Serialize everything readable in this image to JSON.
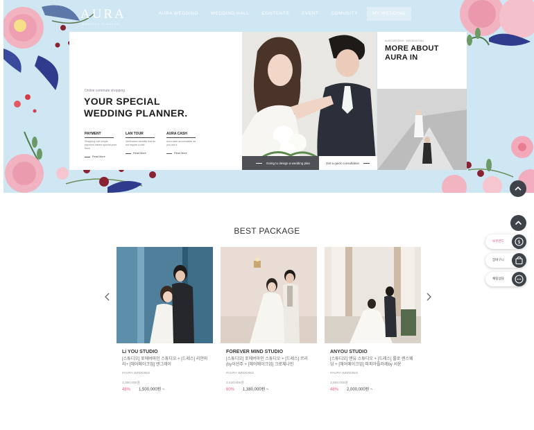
{
  "header": {
    "logo": "AURA",
    "logo_sub": "WEDDING PLANNER",
    "nav": [
      "AURA WEDDING",
      "WEDDING HALL",
      "CONTENTS",
      "EVENT",
      "COMUNITY",
      "MY WEDDING"
    ]
  },
  "hero": {
    "eyebrow": "Online commute shopping",
    "headline_line1": "YOUR SPECIAL",
    "headline_line2": "WEDDING PLANNER.",
    "features": [
      {
        "title": "PAYMENT",
        "desc": "Shopping cart simple payment instant special price fixed",
        "link": "Read More"
      },
      {
        "title": "LAN TOUR",
        "desc": "Verification benefits that do not require a visit",
        "link": "Read More"
      },
      {
        "title": "AURA CASH",
        "desc": "Aura cash accumulates as you use it",
        "link": "Read More"
      }
    ],
    "bar_left": "Going to design a wedding plan",
    "bar_right": "Get a quick consultation",
    "more_eyebrow": "AURA WEDDING · WEDDING HALL",
    "more_title_line1": "MORE ABOUT",
    "more_title_line2": "AURA IN"
  },
  "best": {
    "title": "BEST PACKAGE",
    "products": [
      {
        "name": "Li YOU STUDIO",
        "desc": "[스튜디오] 포에버마인 스튜디오 + [드레스] 리안마리+ [헤어메이크업] 엔그레이",
        "tag": "#AURA WEDDING",
        "orig": "3,360,000원",
        "discount": "48%",
        "price": "1,500,000원 ~"
      },
      {
        "name": "FOREVER MIND STUDIO",
        "desc": "[스튜디오] 포에버마인 스튜디오 + [드레스] 르리(by이선주 + [헤어메이크업] 크로체나인",
        "tag": "#AURA WEDDING",
        "orig": "3,430,000원",
        "discount": "60%",
        "price": "1,380,000원 ~"
      },
      {
        "name": "ANYOU STUDIO",
        "desc": "[스튜디오] 앤유 스튜디오 + [드레스] 룰로 렌스웨딩 + [헤어메이크업] 파파야플러레by 서윤",
        "tag": "#AURA WEDDING",
        "orig": "3,850,000원",
        "discount": "48%",
        "price": "2,000,000원 ~"
      }
    ]
  },
  "side": {
    "items": [
      {
        "label": "보유안드",
        "icon": "dollar-icon"
      },
      {
        "label": "장바구니",
        "icon": "bag-icon"
      },
      {
        "label": "채팅상담",
        "icon": "chat-icon"
      }
    ]
  },
  "colors": {
    "hero_bg": "#cfe6f3",
    "accent_pink": "#e75d90",
    "dark_button": "#3e434a"
  }
}
